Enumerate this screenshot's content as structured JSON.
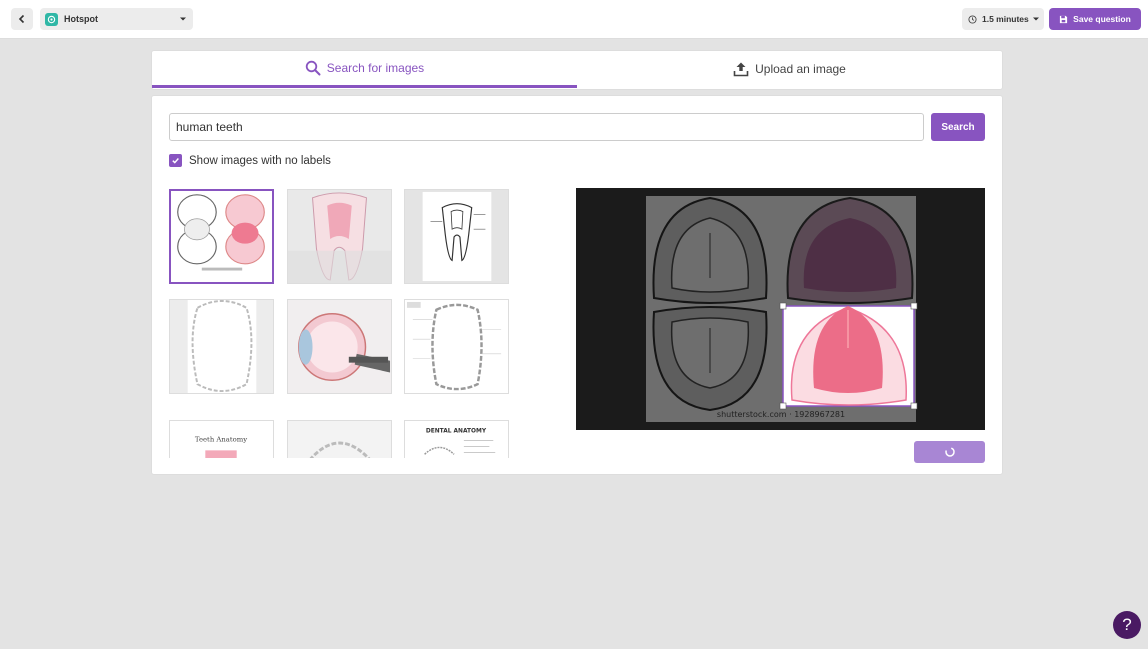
{
  "topbar": {
    "back_icon": "chevron-left-icon",
    "question_type": "Hotspot",
    "time_label": "1.5 minutes",
    "save_label": "Save question"
  },
  "tabs": {
    "search_label": "Search for images",
    "upload_label": "Upload an image",
    "active": "search"
  },
  "search": {
    "value": "human teeth",
    "button_label": "Search"
  },
  "filter": {
    "no_labels_label": "Show images with no labels",
    "checked": true
  },
  "thumbnails": [
    {
      "id": "dental-arches-color",
      "selected": true
    },
    {
      "id": "tooth-cross-section-pink"
    },
    {
      "id": "tooth-diagram-lineart"
    },
    {
      "id": "arch-outline-faint"
    },
    {
      "id": "eye-anatomy"
    },
    {
      "id": "arch-labeled-chart"
    },
    {
      "id": "teeth-anatomy",
      "caption": "Teeth Anatomy"
    },
    {
      "id": "arch-outline-partial"
    },
    {
      "id": "dental-anatomy",
      "caption": "DENTAL ANATOMY"
    }
  ],
  "preview": {
    "watermark": "shutterstock.com · 1928967281"
  },
  "help_label": "?",
  "colors": {
    "accent": "#8854c0",
    "accent_light": "#a886d4",
    "help_bg": "#4a1a63",
    "teal": "#2fb7a6"
  }
}
